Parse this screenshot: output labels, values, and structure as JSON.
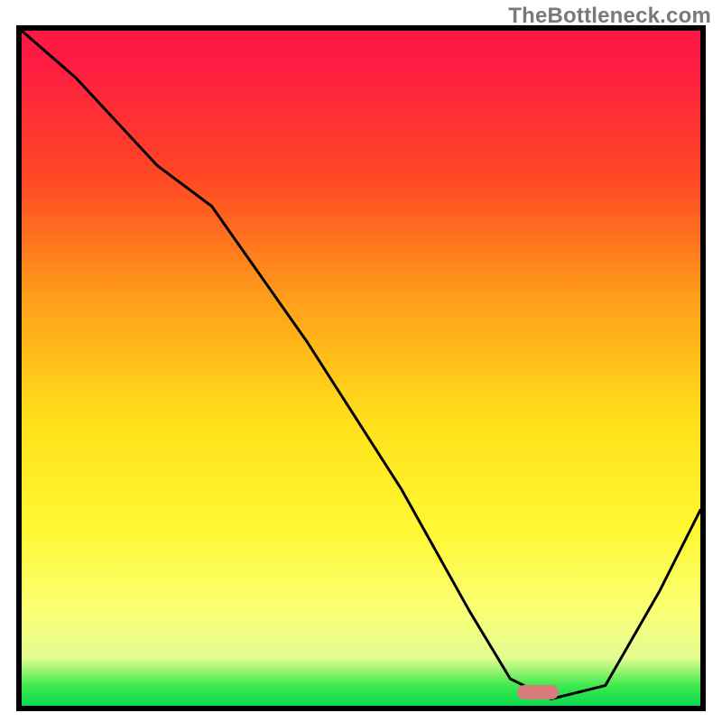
{
  "watermark": "TheBottleneck.com",
  "colors": {
    "top": "#ff1e4b",
    "mid": "#ffd83a",
    "bottom": "#14c455",
    "marker": "#d97a7a",
    "border": "#000000"
  },
  "chart_data": {
    "type": "line",
    "title": "",
    "xlabel": "",
    "ylabel": "",
    "xlim": [
      0,
      100
    ],
    "ylim": [
      0,
      100
    ],
    "series": [
      {
        "name": "bottleneck-curve",
        "x": [
          0,
          8,
          20,
          28,
          42,
          56,
          66,
          72,
          78,
          86,
          94,
          100
        ],
        "values": [
          100,
          93,
          80,
          74,
          54,
          32,
          14,
          4,
          1,
          3,
          17,
          29
        ]
      }
    ],
    "marker": {
      "x": 76,
      "y": 2,
      "width": 6
    },
    "annotations": []
  }
}
